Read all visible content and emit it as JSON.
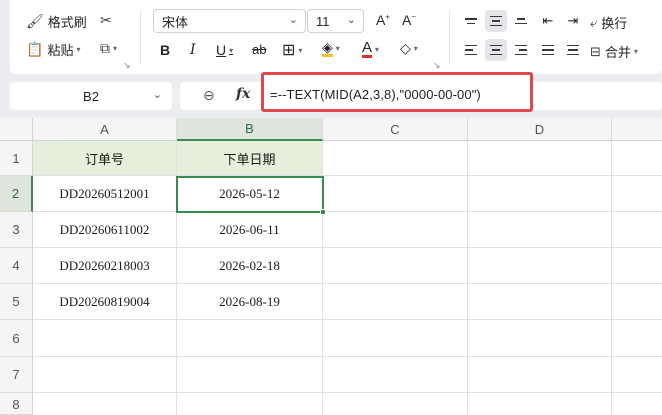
{
  "ribbon": {
    "format_painter": "格式刷",
    "paste": "粘贴",
    "font_name": "宋体",
    "font_size": "11",
    "wrap": "换行",
    "merge": "合并",
    "bold": "B",
    "italic": "I",
    "underline": "U",
    "strike": "ab",
    "font_color_letter": "A"
  },
  "formula_bar": {
    "name_box": "B2",
    "fx_label": "fx",
    "formula": "=--TEXT(MID(A2,3,8),\"0000-00-00\")"
  },
  "sheet": {
    "columns": [
      "A",
      "B",
      "C",
      "D"
    ],
    "rows": [
      "1",
      "2",
      "3",
      "4",
      "5",
      "6",
      "7",
      "8"
    ],
    "selected_cell": "B2",
    "cells": [
      [
        "订单号",
        "下单日期"
      ],
      [
        "DD20260512001",
        "2026-05-12"
      ],
      [
        "DD20260611002",
        "2026-06-11"
      ],
      [
        "DD20260218003",
        "2026-02-18"
      ],
      [
        "DD20260819004",
        "2026-08-19"
      ]
    ]
  },
  "colors": {
    "accent_green": "#3b8a52",
    "header_fill": "#e6efdc",
    "highlight_red": "#e0484e"
  }
}
